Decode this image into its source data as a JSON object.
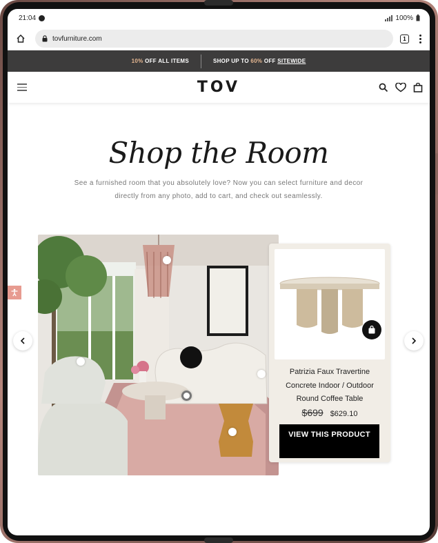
{
  "status_bar": {
    "time": "21:04",
    "battery": "100%"
  },
  "browser": {
    "url": "tovfurniture.com",
    "tab_count": "1"
  },
  "promo": {
    "left_accent": "10%",
    "left_text": " OFF ALL ITEMS",
    "right_prefix": "SHOP UP TO ",
    "right_accent": "60%",
    "right_middle": " OFF ",
    "right_link": "SITEWIDE"
  },
  "header": {
    "logo": "TOV"
  },
  "hero": {
    "title": "Shop the Room",
    "description": "See a furnished room that you absolutely love? Now you can select furniture and decor directly from any photo, add to cart, and check out seamlessly."
  },
  "product": {
    "name": "Patrizia Faux Travertine Concrete Indoor / Outdoor Round Coffee Table",
    "old_price": "$699",
    "new_price": "$629.10",
    "cta": "VIEW THIS PRODUCT"
  },
  "colors": {
    "promo_bg": "#3d3c3c",
    "promo_accent": "#e7b892",
    "cta_bg": "#000000",
    "card_bg": "#f1ede6",
    "accessibility": "#e79b90"
  },
  "icons": [
    "home-icon",
    "lock-icon",
    "menu-icon",
    "search-icon",
    "heart-icon",
    "bag-icon",
    "chevron-left-icon",
    "chevron-right-icon",
    "accessibility-icon"
  ]
}
